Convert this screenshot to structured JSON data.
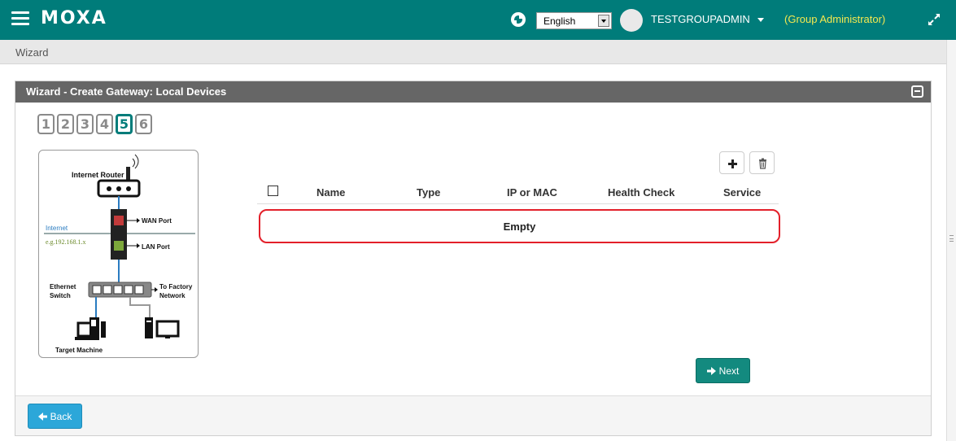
{
  "navbar": {
    "logo": "MOXA",
    "language": "English",
    "user_name": "TESTGROUPADMIN",
    "role": "(Group Administrator)",
    "bg_color": "#007c7a"
  },
  "breadcrumb": "Wizard",
  "panel": {
    "title": "Wizard - Create Gateway: Local Devices"
  },
  "steps": [
    "1",
    "2",
    "3",
    "4",
    "5",
    "6"
  ],
  "active_step": "5",
  "diagram": {
    "router_label": "Internet Router",
    "wan_label": "WAN Port",
    "internet_label": "Internet",
    "subnet_label": "e.g.192.168.1.x",
    "lan_label": "LAN Port",
    "switch_label_1": "Ethernet",
    "switch_label_2": "Switch",
    "factory_label_1": "To Factory",
    "factory_label_2": "Network",
    "target_label": "Target Machine"
  },
  "table": {
    "columns": [
      "Name",
      "Type",
      "IP or MAC",
      "Health Check",
      "Service"
    ],
    "empty_text": "Empty"
  },
  "buttons": {
    "next": "Next",
    "back": "Back"
  },
  "icons": {
    "add": "plus-icon",
    "delete": "trash-icon",
    "next": "arrow-right-icon",
    "back": "arrow-left-icon"
  }
}
